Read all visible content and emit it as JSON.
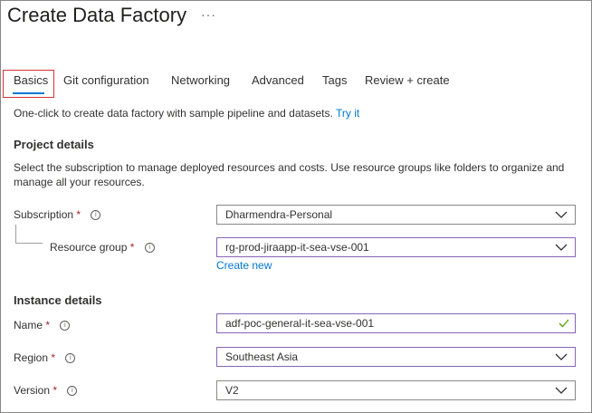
{
  "header": {
    "title": "Create Data Factory",
    "more": "···"
  },
  "tabs": [
    {
      "label": "Basics",
      "active": true
    },
    {
      "label": "Git configuration"
    },
    {
      "label": "Networking"
    },
    {
      "label": "Advanced"
    },
    {
      "label": "Tags"
    },
    {
      "label": "Review + create"
    }
  ],
  "intro": {
    "text": "One-click to create data factory with sample pipeline and datasets.",
    "link": "Try it"
  },
  "project": {
    "heading": "Project details",
    "description_line1": "Select the subscription to manage deployed resources and costs. Use resource groups like folders to organize and",
    "description_line2": "manage all your resources.",
    "subscription_label": "Subscription",
    "subscription_value": "Dharmendra-Personal",
    "resource_group_label": "Resource group",
    "resource_group_value": "rg-prod-jiraapp-it-sea-vse-001",
    "create_new": "Create new"
  },
  "instance": {
    "heading": "Instance details",
    "name_label": "Name",
    "name_value": "adf-poc-general-it-sea-vse-001",
    "region_label": "Region",
    "region_value": "Southeast Asia",
    "version_label": "Version",
    "version_value": "V2"
  },
  "common": {
    "required": "*",
    "info": "i"
  },
  "colors": {
    "accent": "#0078d4",
    "active_tab_border": "#d13438",
    "focus_border": "#8764b8",
    "valid_check": "#57a300"
  }
}
